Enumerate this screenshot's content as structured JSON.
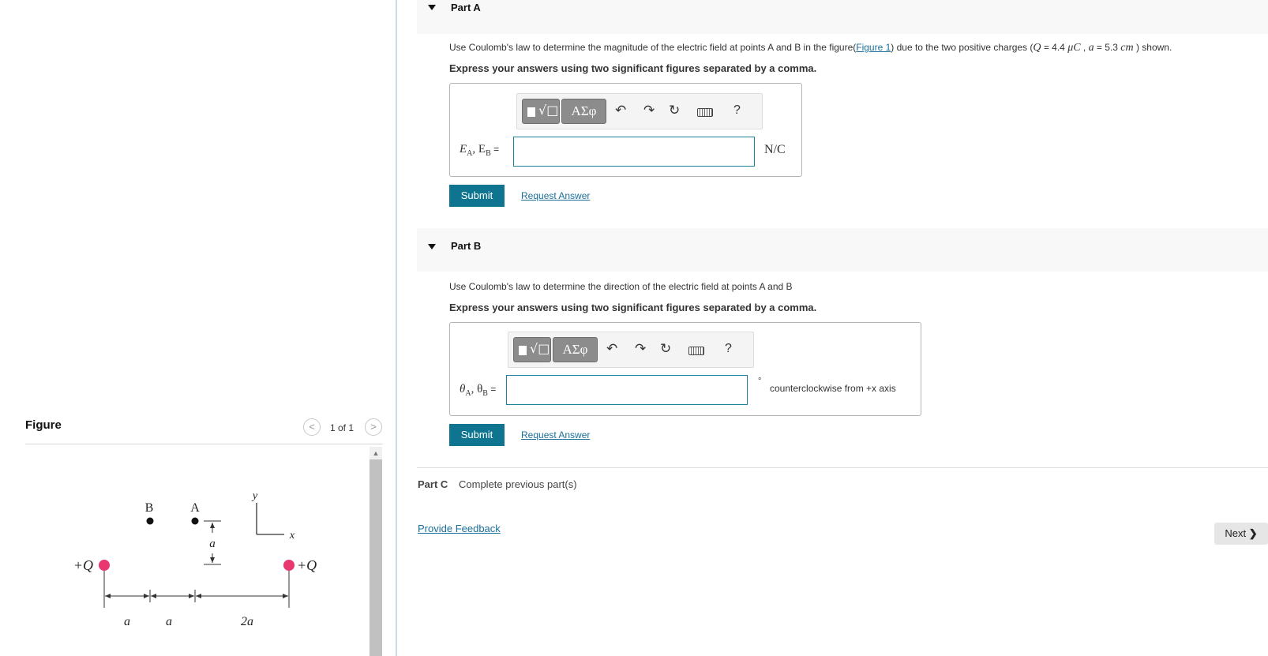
{
  "figure": {
    "title": "Figure",
    "prev_icon": "chevron-left-icon",
    "next_icon": "chevron-right-icon",
    "counter": "1 of 1",
    "diagram": {
      "left_charge_label": "+Q",
      "right_charge_label": "+Q",
      "point_b_label": "B",
      "point_a_label": "A",
      "vertical_dim_label": "a",
      "axis_y_label": "y",
      "axis_x_label": "x",
      "dim1_label": "a",
      "dim2_label": "a",
      "dim3_label": "2a",
      "charge_color": "#e8386f"
    }
  },
  "partA": {
    "label": "Part A",
    "question_pre": "Use Coulomb's law to determine the magnitude of the electric field at points A and B in the figure(",
    "figure_link": "Figure 1",
    "question_mid": ") due to the two positive charges (",
    "Q_sym": "Q",
    "Q_val": " = 4.4 ",
    "Q_unit": "μC",
    "a_sep": " , ",
    "a_sym": "a",
    "a_val": " = 5.3 ",
    "a_unit": "cm",
    "question_post": " ) shown.",
    "instructions": "Express your answers using two significant figures separated by a comma.",
    "toolbar_greek": "ΑΣφ",
    "help": "?",
    "lhs_E": "E",
    "lhs_sub1": "A",
    "lhs_sep": ", E",
    "lhs_sub2": "B",
    "lhs_eq": " =",
    "input_value": "",
    "unit": "N/C",
    "submit": "Submit",
    "request": "Request Answer"
  },
  "partB": {
    "label": "Part B",
    "question": "Use Coulomb's law to determine the direction of the electric field at points A and B",
    "instructions": "Express your answers using two significant figures separated by a comma.",
    "toolbar_greek": "ΑΣφ",
    "help": "?",
    "lhs_theta": "θ",
    "lhs_sub1": "A",
    "lhs_sep": ", θ",
    "lhs_sub2": "B",
    "lhs_eq": " =",
    "input_value": "",
    "unit_degree": "°",
    "unit_text": "counterclockwise from +x axis",
    "submit": "Submit",
    "request": "Request Answer"
  },
  "partC": {
    "label": "Part C",
    "text": "Complete previous part(s)"
  },
  "footer": {
    "feedback": "Provide Feedback",
    "next": "Next",
    "next_icon": "chevron-right-icon"
  },
  "colors": {
    "accent": "#0f7490",
    "link": "#1a6f9a",
    "input_border": "#1a8196"
  }
}
